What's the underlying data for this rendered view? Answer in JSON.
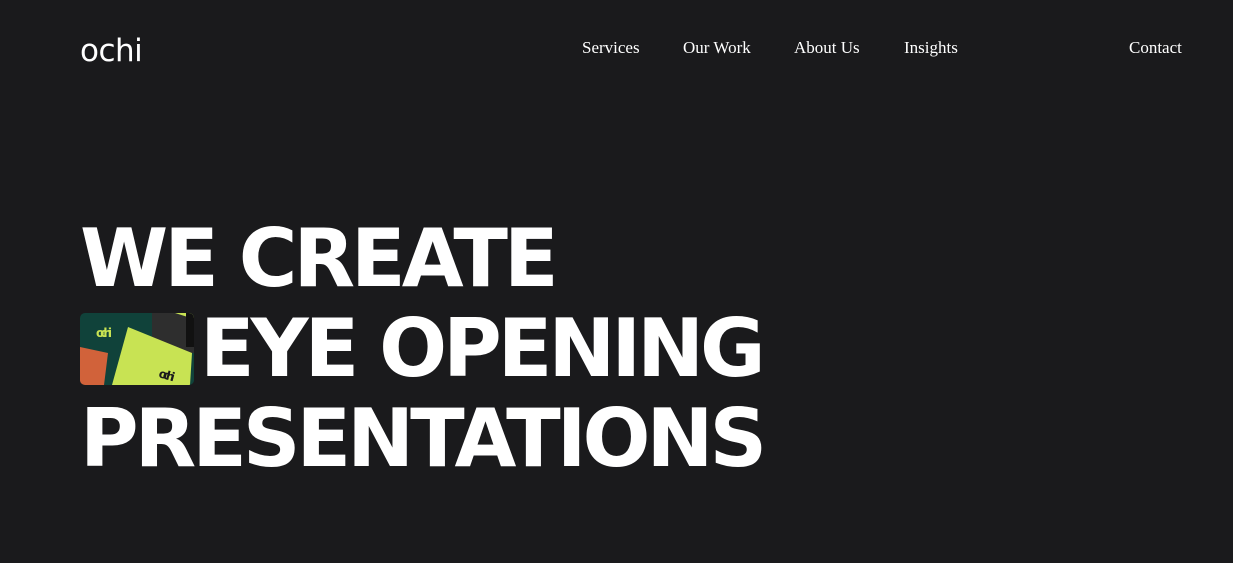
{
  "brand": {
    "logo_text": "ochi",
    "logo_icon": "ochi-logo"
  },
  "nav": {
    "items": [
      {
        "label": "Services"
      },
      {
        "label": "Our Work"
      },
      {
        "label": "About Us"
      },
      {
        "label": "Insights"
      }
    ],
    "contact_label": "Contact"
  },
  "hero": {
    "lines": [
      "WE CREATE",
      "EYE OPENING",
      "PRESENTATIONS"
    ],
    "thumbnail": {
      "icon": "presentation-thumbnail-image",
      "card_text_top": "ochi",
      "card_text_bottom": "ochi",
      "colors": {
        "dark_green": "#10423a",
        "lime": "#c8e353",
        "orange": "#d1623a",
        "charcoal": "#2e2e2e"
      }
    }
  },
  "colors": {
    "background": "#1a1a1c",
    "text": "#ffffff"
  }
}
